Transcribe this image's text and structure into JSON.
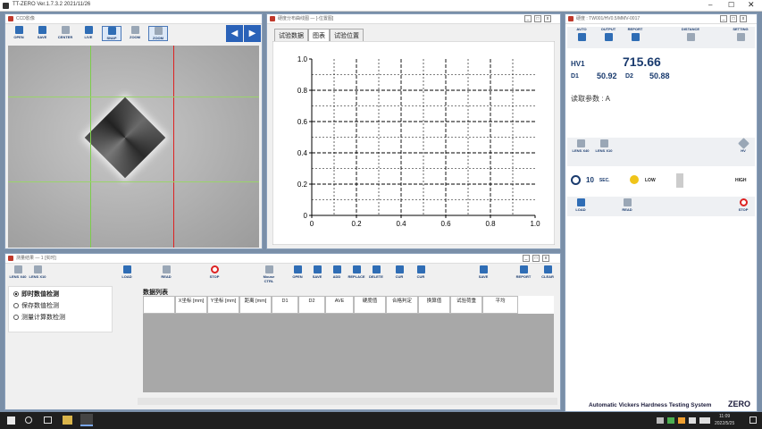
{
  "app": {
    "title": "TT-ZERO Ver.1.7.3.2  2021/11/26"
  },
  "ccd": {
    "title": "CCD影像",
    "buttons": [
      {
        "label": "OPEN"
      },
      {
        "label": "SAVE"
      },
      {
        "label": "CENTER"
      },
      {
        "label": "LIVE"
      },
      {
        "label": "SNAP"
      },
      {
        "label": "ZOOM"
      },
      {
        "label": "ZOOM"
      }
    ]
  },
  "chart_win": {
    "title": "硬度分布曲线图 — [-位置图]",
    "tabs": [
      "试验数据",
      "图表",
      "试验位置"
    ],
    "chart_data": {
      "type": "line",
      "series": [],
      "xlim": [
        0,
        1
      ],
      "ylim": [
        0,
        1
      ],
      "xticks": [
        "0",
        "0.2",
        "0.4",
        "0.6",
        "0.8",
        "1.0"
      ],
      "yticks": [
        "0",
        "0.2",
        "0.4",
        "0.6",
        "0.8",
        "1.0"
      ],
      "grid": true
    }
  },
  "hv_win": {
    "title": "硬度 : TW001/HV0.5/MMV-0017",
    "buttons": [
      "AUTO",
      "OUTPUT",
      "REPORT",
      "DISTANCE",
      "SETTING"
    ],
    "hv_label": "HV1",
    "hv_value": "715.66",
    "d1_label": "D1",
    "d1_value": "50.92",
    "d2_label": "D2",
    "d2_value": "50.88",
    "read_param": "读取参数 : A",
    "lens1": "LENS X40",
    "lens2": "LENS X10",
    "hv_btn": "HV",
    "time_value": "10",
    "time_unit": "SEC.",
    "level_low": "LOW",
    "level_high": "HIGH",
    "load": "LOAD",
    "read": "READ",
    "stop": "STOP"
  },
  "meas_win": {
    "title": "测量结果 — 1 [实时]",
    "toolbar_left": [
      "LENS X40",
      "LENS X10",
      "LOAD",
      "READ",
      "STOP",
      "Mouse CTRL"
    ],
    "toolbar_right": [
      "OPEN",
      "SAVE",
      "ADD",
      "REPLACE",
      "DELETE",
      "CUR",
      "CUR",
      "SAVE",
      "REPORT",
      "CLEAR"
    ],
    "options": [
      "即时数值检测",
      "保存数值检测",
      "测量计算数检测"
    ],
    "data_list_title": "数据列表",
    "columns": [
      "",
      "X坐标 [mm]",
      "Y坐标 [mm]",
      "距离 [mm]",
      "D1",
      "D2",
      "AVE",
      "硬度值",
      "合格判定",
      "换算值",
      "试验荷重",
      "平均"
    ]
  },
  "footer": {
    "brand_text": "Automatic Vickers Hardness Testing System",
    "brand_logo": "ZERO"
  },
  "taskbar": {
    "time": "11:09",
    "date": "2022/5/25"
  }
}
